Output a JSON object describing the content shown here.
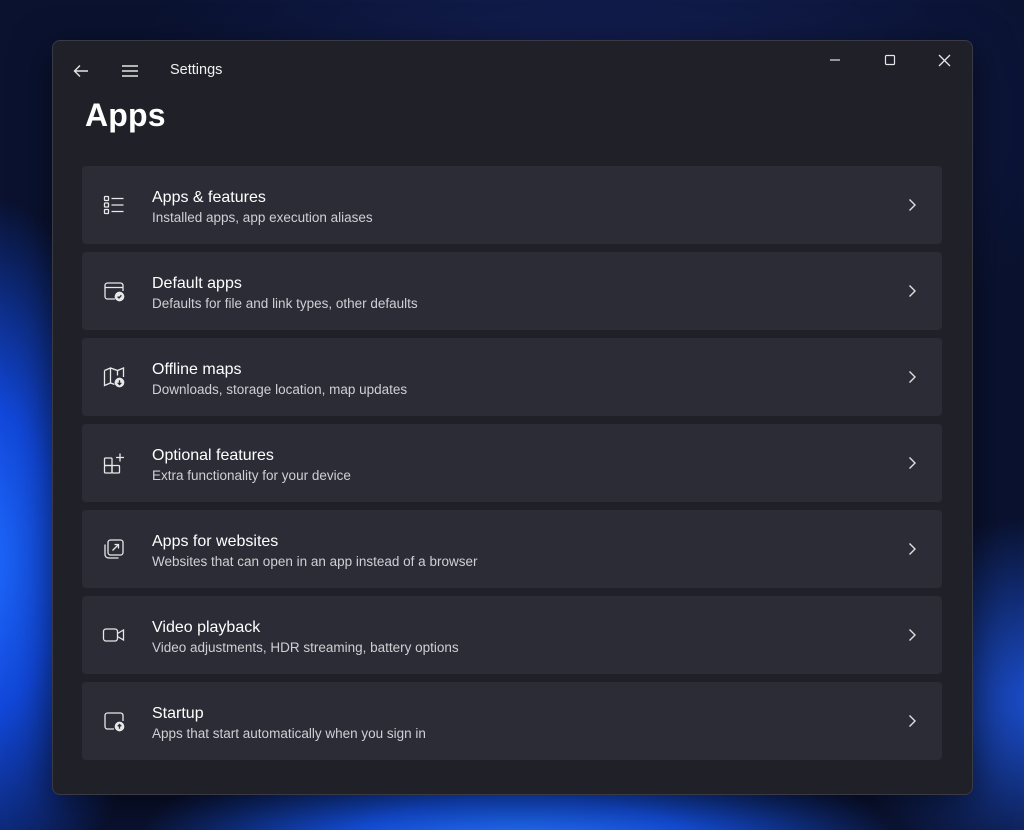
{
  "window": {
    "title": "Settings"
  },
  "page": {
    "title": "Apps"
  },
  "items": [
    {
      "icon": "list-icon",
      "title": "Apps & features",
      "description": "Installed apps, app execution aliases"
    },
    {
      "icon": "default-apps-icon",
      "title": "Default apps",
      "description": "Defaults for file and link types, other defaults"
    },
    {
      "icon": "map-download-icon",
      "title": "Offline maps",
      "description": "Downloads, storage location, map updates"
    },
    {
      "icon": "grid-plus-icon",
      "title": "Optional features",
      "description": "Extra functionality for your device"
    },
    {
      "icon": "open-external-icon",
      "title": "Apps for websites",
      "description": "Websites that can open in an app instead of a browser"
    },
    {
      "icon": "video-camera-icon",
      "title": "Video playback",
      "description": "Video adjustments, HDR streaming, battery options"
    },
    {
      "icon": "startup-icon",
      "title": "Startup",
      "description": "Apps that start automatically when you sign in"
    }
  ],
  "colors": {
    "window_bg": "#202028",
    "card_bg": "#2c2c36",
    "text": "#ffffff",
    "subtext": "#cfcfd4"
  }
}
